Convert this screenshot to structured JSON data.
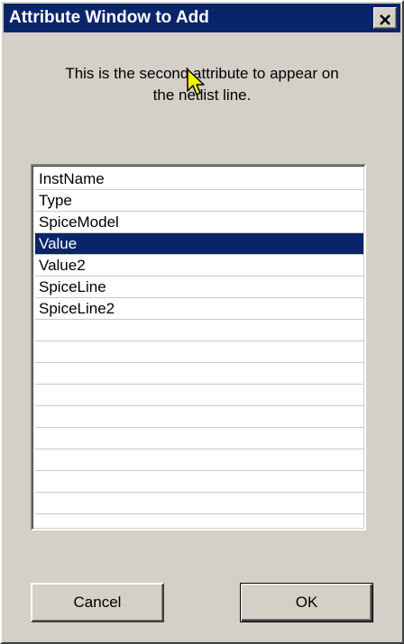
{
  "window": {
    "title": "Attribute Window to Add",
    "close_label": "✕"
  },
  "instruction": {
    "line1": "This is the second attribute to appear on",
    "line2": "the netlist line."
  },
  "attribute_list": {
    "items": [
      "InstName",
      "Type",
      "SpiceModel",
      "Value",
      "Value2",
      "SpiceLine",
      "SpiceLine2",
      "",
      "",
      "",
      "",
      "",
      "",
      "",
      "",
      "",
      ""
    ],
    "selected": "Value"
  },
  "buttons": {
    "cancel_label": "Cancel",
    "ok_label": "OK"
  },
  "colors": {
    "titlebar": "#0a246a",
    "selection": "#0a246a",
    "face": "#d4d0c8",
    "cursor": "#f5f500"
  },
  "icons": {
    "close": "close-icon",
    "pointer": "mouse-pointer-icon"
  }
}
